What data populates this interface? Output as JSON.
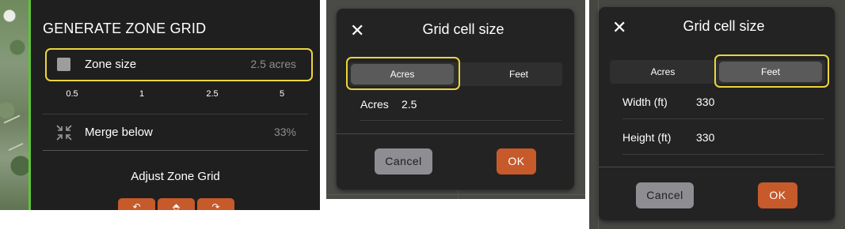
{
  "zone_grid_panel": {
    "title": "GENERATE ZONE GRID",
    "zone_size_label": "Zone size",
    "zone_size_value": "2.5 acres",
    "slider_ticks": [
      "0.5",
      "1",
      "2.5",
      "5"
    ],
    "merge_label": "Merge below",
    "merge_value": "33%",
    "adjust_label": "Adjust Zone Grid",
    "adjust_buttons": [
      {
        "icon": "undo-arrow-icon",
        "glyph": "↶"
      },
      {
        "icon": "up-arrow-icon",
        "glyph": "⬘"
      },
      {
        "icon": "redo-arrow-icon",
        "glyph": "↷"
      }
    ],
    "colors": {
      "accent": "#5ec437",
      "highlight": "#ecd53a",
      "button": "#c65a2b"
    }
  },
  "acres_dialog": {
    "close_glyph": "✕",
    "title": "Grid cell size",
    "tabs": [
      {
        "label": "Acres",
        "active": true
      },
      {
        "label": "Feet",
        "active": false
      }
    ],
    "fields": [
      {
        "label": "Acres",
        "value": "2.5"
      }
    ],
    "cancel_label": "Cancel",
    "ok_label": "OK"
  },
  "feet_dialog": {
    "close_glyph": "✕",
    "title": "Grid cell size",
    "tabs": [
      {
        "label": "Acres",
        "active": false
      },
      {
        "label": "Feet",
        "active": true
      }
    ],
    "fields": [
      {
        "label": "Width (ft)",
        "value": "330"
      },
      {
        "label": "Height (ft)",
        "value": "330"
      }
    ],
    "cancel_label": "Cancel",
    "ok_label": "OK"
  }
}
